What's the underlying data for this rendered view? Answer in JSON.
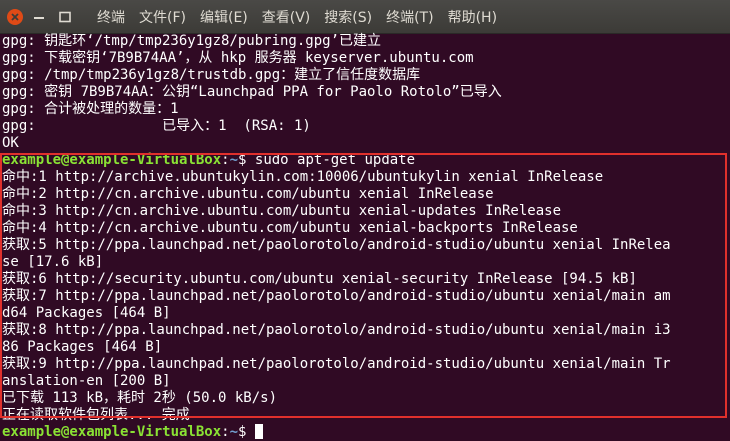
{
  "window": {
    "close_icon": "close-icon",
    "minimize_icon": "minimize-icon",
    "maximize_icon": "maximize-icon",
    "close_color": "#df4a16"
  },
  "menu": [
    "终端",
    "文件(F)",
    "编辑(E)",
    "查看(V)",
    "搜索(S)",
    "终端(T)",
    "帮助(H)"
  ],
  "colors": {
    "background": "#300a24",
    "prompt_user": "#8ae234",
    "prompt_path": "#729fcf",
    "highlight_box": "#e0302c"
  },
  "output_before": [
    "gpg: 钥匙环‘/tmp/tmp236y1gz8/pubring.gpg’已建立",
    "gpg: 下载密钥‘7B9B74AA’，从 hkp 服务器 keyserver.ubuntu.com",
    "gpg: /tmp/tmp236y1gz8/trustdb.gpg：建立了信任度数据库",
    "gpg: 密钥 7B9B74AA：公钥“Launchpad PPA for Paolo Rotolo”已导入",
    "gpg: 合计被处理的数量：1",
    "gpg:               已导入：1  (RSA: 1)",
    "OK"
  ],
  "prompt1": {
    "user": "example@example-VirtualBox",
    "sep": ":",
    "path": "~",
    "symbol": "$ ",
    "command": "sudo apt-get update"
  },
  "output_update": [
    "命中:1 http://archive.ubuntukylin.com:10006/ubuntukylin xenial InRelease",
    "命中:2 http://cn.archive.ubuntu.com/ubuntu xenial InRelease",
    "命中:3 http://cn.archive.ubuntu.com/ubuntu xenial-updates InRelease",
    "命中:4 http://cn.archive.ubuntu.com/ubuntu xenial-backports InRelease",
    "获取:5 http://ppa.launchpad.net/paolorotolo/android-studio/ubuntu xenial InRelea",
    "se [17.6 kB]",
    "获取:6 http://security.ubuntu.com/ubuntu xenial-security InRelease [94.5 kB]",
    "获取:7 http://ppa.launchpad.net/paolorotolo/android-studio/ubuntu xenial/main am",
    "d64 Packages [464 B]",
    "获取:8 http://ppa.launchpad.net/paolorotolo/android-studio/ubuntu xenial/main i3",
    "86 Packages [464 B]",
    "获取:9 http://ppa.launchpad.net/paolorotolo/android-studio/ubuntu xenial/main Tr",
    "anslation-en [200 B]",
    "已下载 113 kB，耗时 2秒 (50.0 kB/s)",
    "正在读取软件包列表... 完成"
  ],
  "prompt2": {
    "user": "example@example-VirtualBox",
    "sep": ":",
    "path": "~",
    "symbol": "$ "
  }
}
